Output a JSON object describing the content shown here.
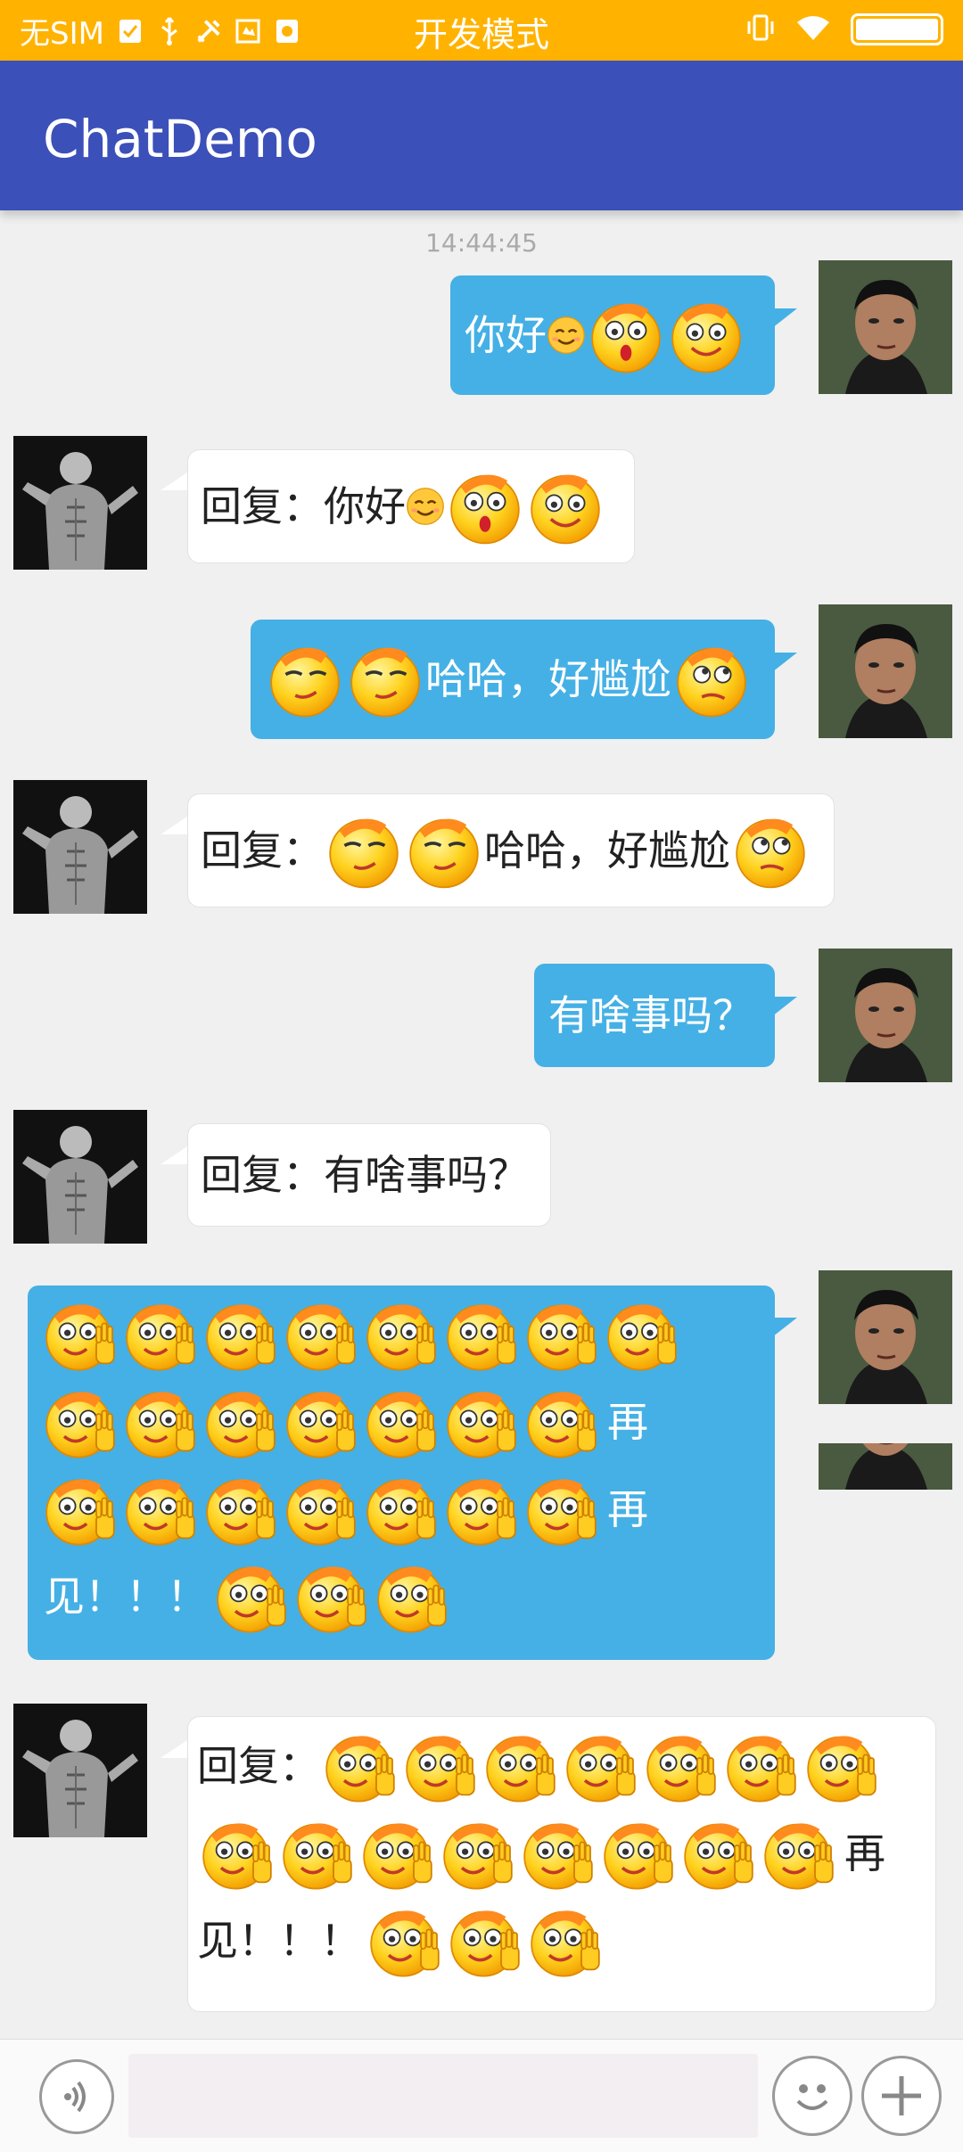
{
  "status_bar": {
    "sim_text": "无SIM",
    "center_text": "开发模式",
    "icons": [
      "check-icon",
      "usb-icon",
      "tools-icon",
      "screenshot-icon",
      "app-icon",
      "vibrate-icon",
      "wifi-icon",
      "battery-icon"
    ]
  },
  "app_bar": {
    "title": "ChatDemo"
  },
  "chat": {
    "timestamp": "14:44:45",
    "messages": [
      {
        "side": "out",
        "text": "你好",
        "emojis": [
          "smile-small",
          "surprised-face",
          "grinning-face"
        ]
      },
      {
        "side": "in",
        "text": "回复：你好",
        "emojis": [
          "smile-small",
          "surprised-face",
          "grinning-face"
        ]
      },
      {
        "side": "out",
        "prefix_emojis": [
          "smug-face",
          "smug-face"
        ],
        "text": "哈哈，好尴尬",
        "suffix_emojis": [
          "rolling-eyes-face"
        ]
      },
      {
        "side": "in",
        "text": "回复：",
        "prefix_emojis": [
          "smug-face",
          "smug-face"
        ],
        "text2": "哈哈，好尴尬",
        "suffix_emojis": [
          "rolling-eyes-face"
        ]
      },
      {
        "side": "out",
        "text": "有啥事吗？"
      },
      {
        "side": "in",
        "text": "回复：有啥事吗？"
      },
      {
        "side": "out",
        "waving_count_line1": 8,
        "waving_count_line2": 7,
        "line2_char": "再",
        "waving_count_line3": 7,
        "line3_char": "再",
        "line4_text": "见！！！",
        "waving_count_line4": 3
      },
      {
        "side": "in",
        "prefix": "回复：",
        "waving_count_line1": 7,
        "waving_count_line2": 8,
        "line2_char": "再",
        "line3_text": "见！！！",
        "waving_count_line3": 3
      }
    ]
  },
  "input_bar": {
    "voice_icon": "voice-icon",
    "input_value": "",
    "emoji_icon": "emoji-icon",
    "plus_icon": "plus-icon"
  }
}
